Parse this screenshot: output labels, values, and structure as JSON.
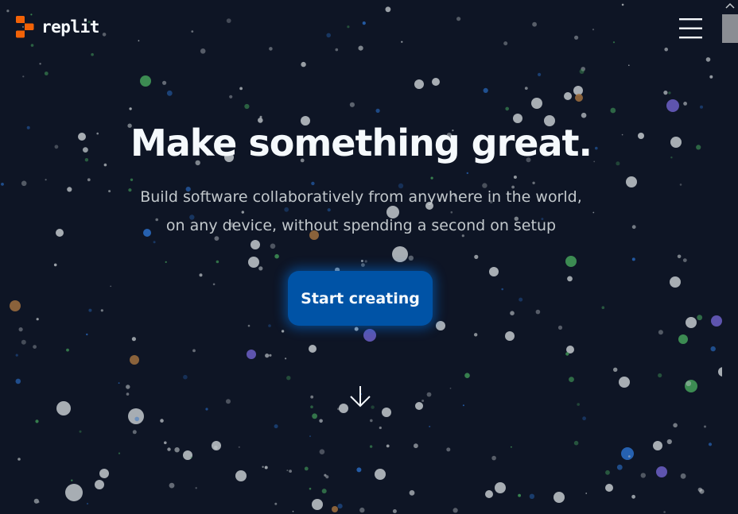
{
  "header": {
    "logo_text": "replit",
    "logo_icon": "replit-logo-icon",
    "menu_icon": "hamburger-menu-icon"
  },
  "hero": {
    "title": "Make something great.",
    "subtitle_line1": "Build software collaboratively from anywhere in the world,",
    "subtitle_line2": "on any device, without spending a second on setup",
    "cta_label": "Start creating",
    "scroll_icon": "arrow-down-icon"
  },
  "scrollbar": {
    "up_icon": "chevron-up-icon"
  },
  "colors": {
    "background": "#0e1525",
    "brand_orange": "#f26207",
    "cta_blue": "#0053a6",
    "title_text": "#f5f9fc",
    "subtitle_text": "#c2c8cc",
    "particle_gray": "#c2c8cc",
    "particle_green": "#44a05b",
    "particle_blue": "#2a6fc9",
    "particle_purple": "#6c5fc7",
    "particle_brown": "#a07040"
  }
}
